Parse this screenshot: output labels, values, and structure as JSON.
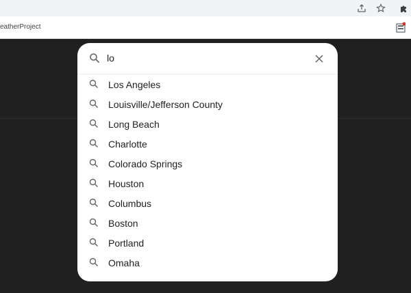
{
  "browser": {
    "icons": [
      "share-icon",
      "star-icon",
      "extensions-icon"
    ],
    "bookmark_label": "eatherProject"
  },
  "search": {
    "query": "lo",
    "icon": "search-icon",
    "close_icon": "close-icon"
  },
  "suggestions": [
    "Los Angeles",
    "Louisville/Jefferson County",
    "Long Beach",
    "Charlotte",
    "Colorado Springs",
    "Houston",
    "Columbus",
    "Boston",
    "Portland",
    "Omaha"
  ]
}
